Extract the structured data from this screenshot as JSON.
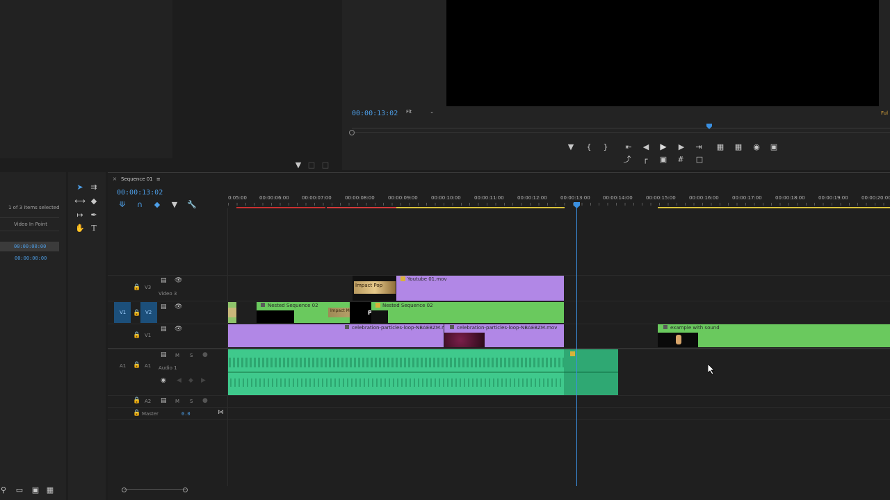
{
  "left_panel": {
    "selection_info": "1 of 3 items selected",
    "column_header": "Video In Point",
    "rows": [
      "00:00:00:00",
      "00:00:00:00"
    ]
  },
  "program_monitor": {
    "timecode": "00:00:13:02",
    "fit_label": "Fit",
    "right_edge_label": "Ful"
  },
  "sequence": {
    "tab_label": "Sequence 01",
    "menu_icon": "≡",
    "timecode": "00:00:13:02",
    "ruler": [
      "0:05:00",
      "00:00:06:00",
      "00:00:07:00",
      "00:00:08:00",
      "00:00:09:00",
      "00:00:10:00",
      "00:00:11:00",
      "00:00:12:00",
      "00:00:13:00",
      "00:00:14:00",
      "00:00:15:00",
      "00:00:16:00",
      "00:00:17:00",
      "00:00:18:00",
      "00:00:19:00",
      "00:00:20:00"
    ]
  },
  "tracks": {
    "v3": {
      "name": "V3",
      "label": "Video 3"
    },
    "v2": {
      "src": "V1",
      "name": "V2"
    },
    "v1": {
      "name": "V1"
    },
    "a1": {
      "src": "A1",
      "name": "A1",
      "label": "Audio 1",
      "m": "M",
      "s": "S"
    },
    "a2": {
      "name": "A2",
      "m": "M",
      "s": "S"
    },
    "master": {
      "label": "Master",
      "value": "0.0"
    }
  },
  "clips": {
    "youtube": "Youtube 01.mov",
    "impact_pop": "Impact Pop",
    "nested1": "Nested Sequence 02",
    "nested2": "Nested Sequence 02",
    "impact_moment": "Impact Moment",
    "pop": "POP",
    "celebration1": "celebration-particles-loop-NBAEBZM.mov",
    "celebration2": "celebration-particles-loop-NBAEBZM.mov",
    "example": "example with sound"
  },
  "colors": {
    "accent": "#4d9fe8",
    "video_clip": "#b187e6",
    "nested_clip": "#6ac95e",
    "audio_clip": "#3fc98c",
    "playhead": "#3a8fe0"
  }
}
